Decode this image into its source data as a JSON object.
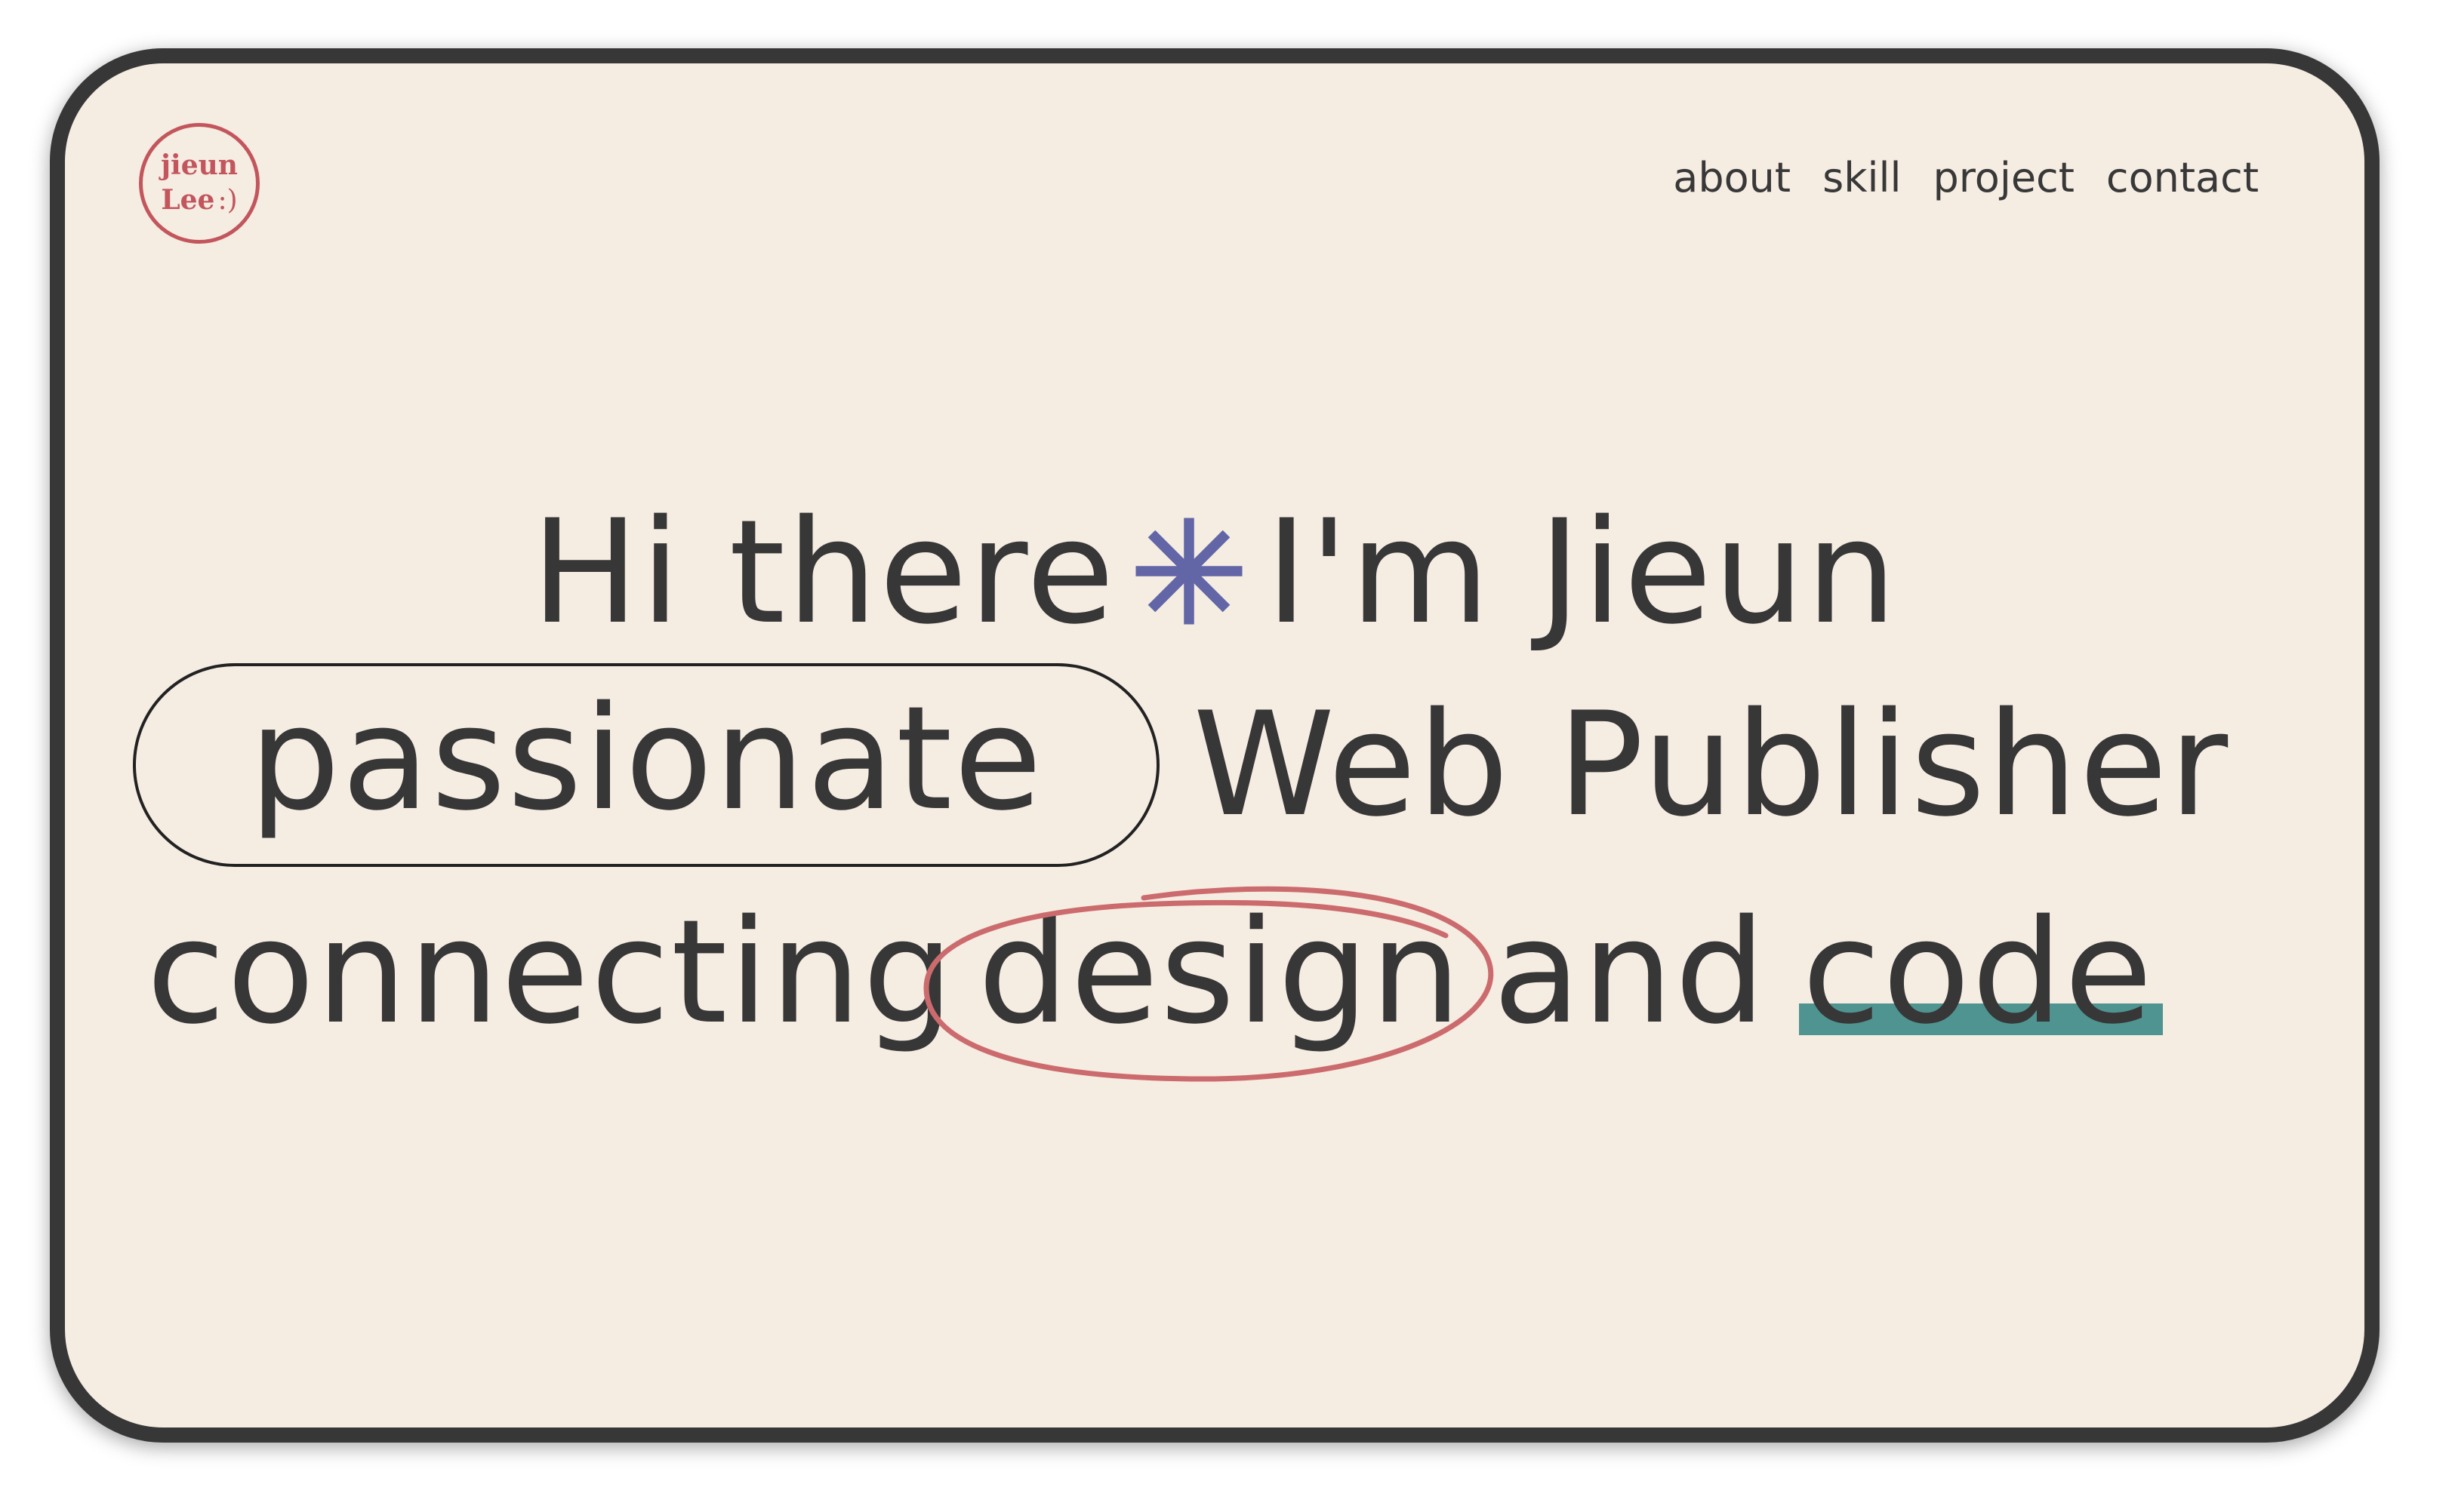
{
  "logo": {
    "line1": "jieun",
    "line2": "Lee",
    "smile": ":)"
  },
  "nav": {
    "items": [
      "about",
      "skill",
      "project",
      "contact"
    ]
  },
  "hero": {
    "line1_start": "Hi there",
    "line1_end": "I'm Jieun",
    "pill_word": "passionate",
    "role": "Web Publisher",
    "line3_word1": "connecting",
    "circled_word": "design",
    "line3_word3": "and",
    "underlined_word": "code"
  },
  "colors": {
    "background": "#f5ece2",
    "frame": "#373737",
    "text": "#373737",
    "logo": "#c3565d",
    "asterisk": "#6265a6",
    "circle": "#cc6b6e",
    "underline": "#4f9490"
  },
  "icons": {
    "asterisk": "asterisk-icon"
  }
}
